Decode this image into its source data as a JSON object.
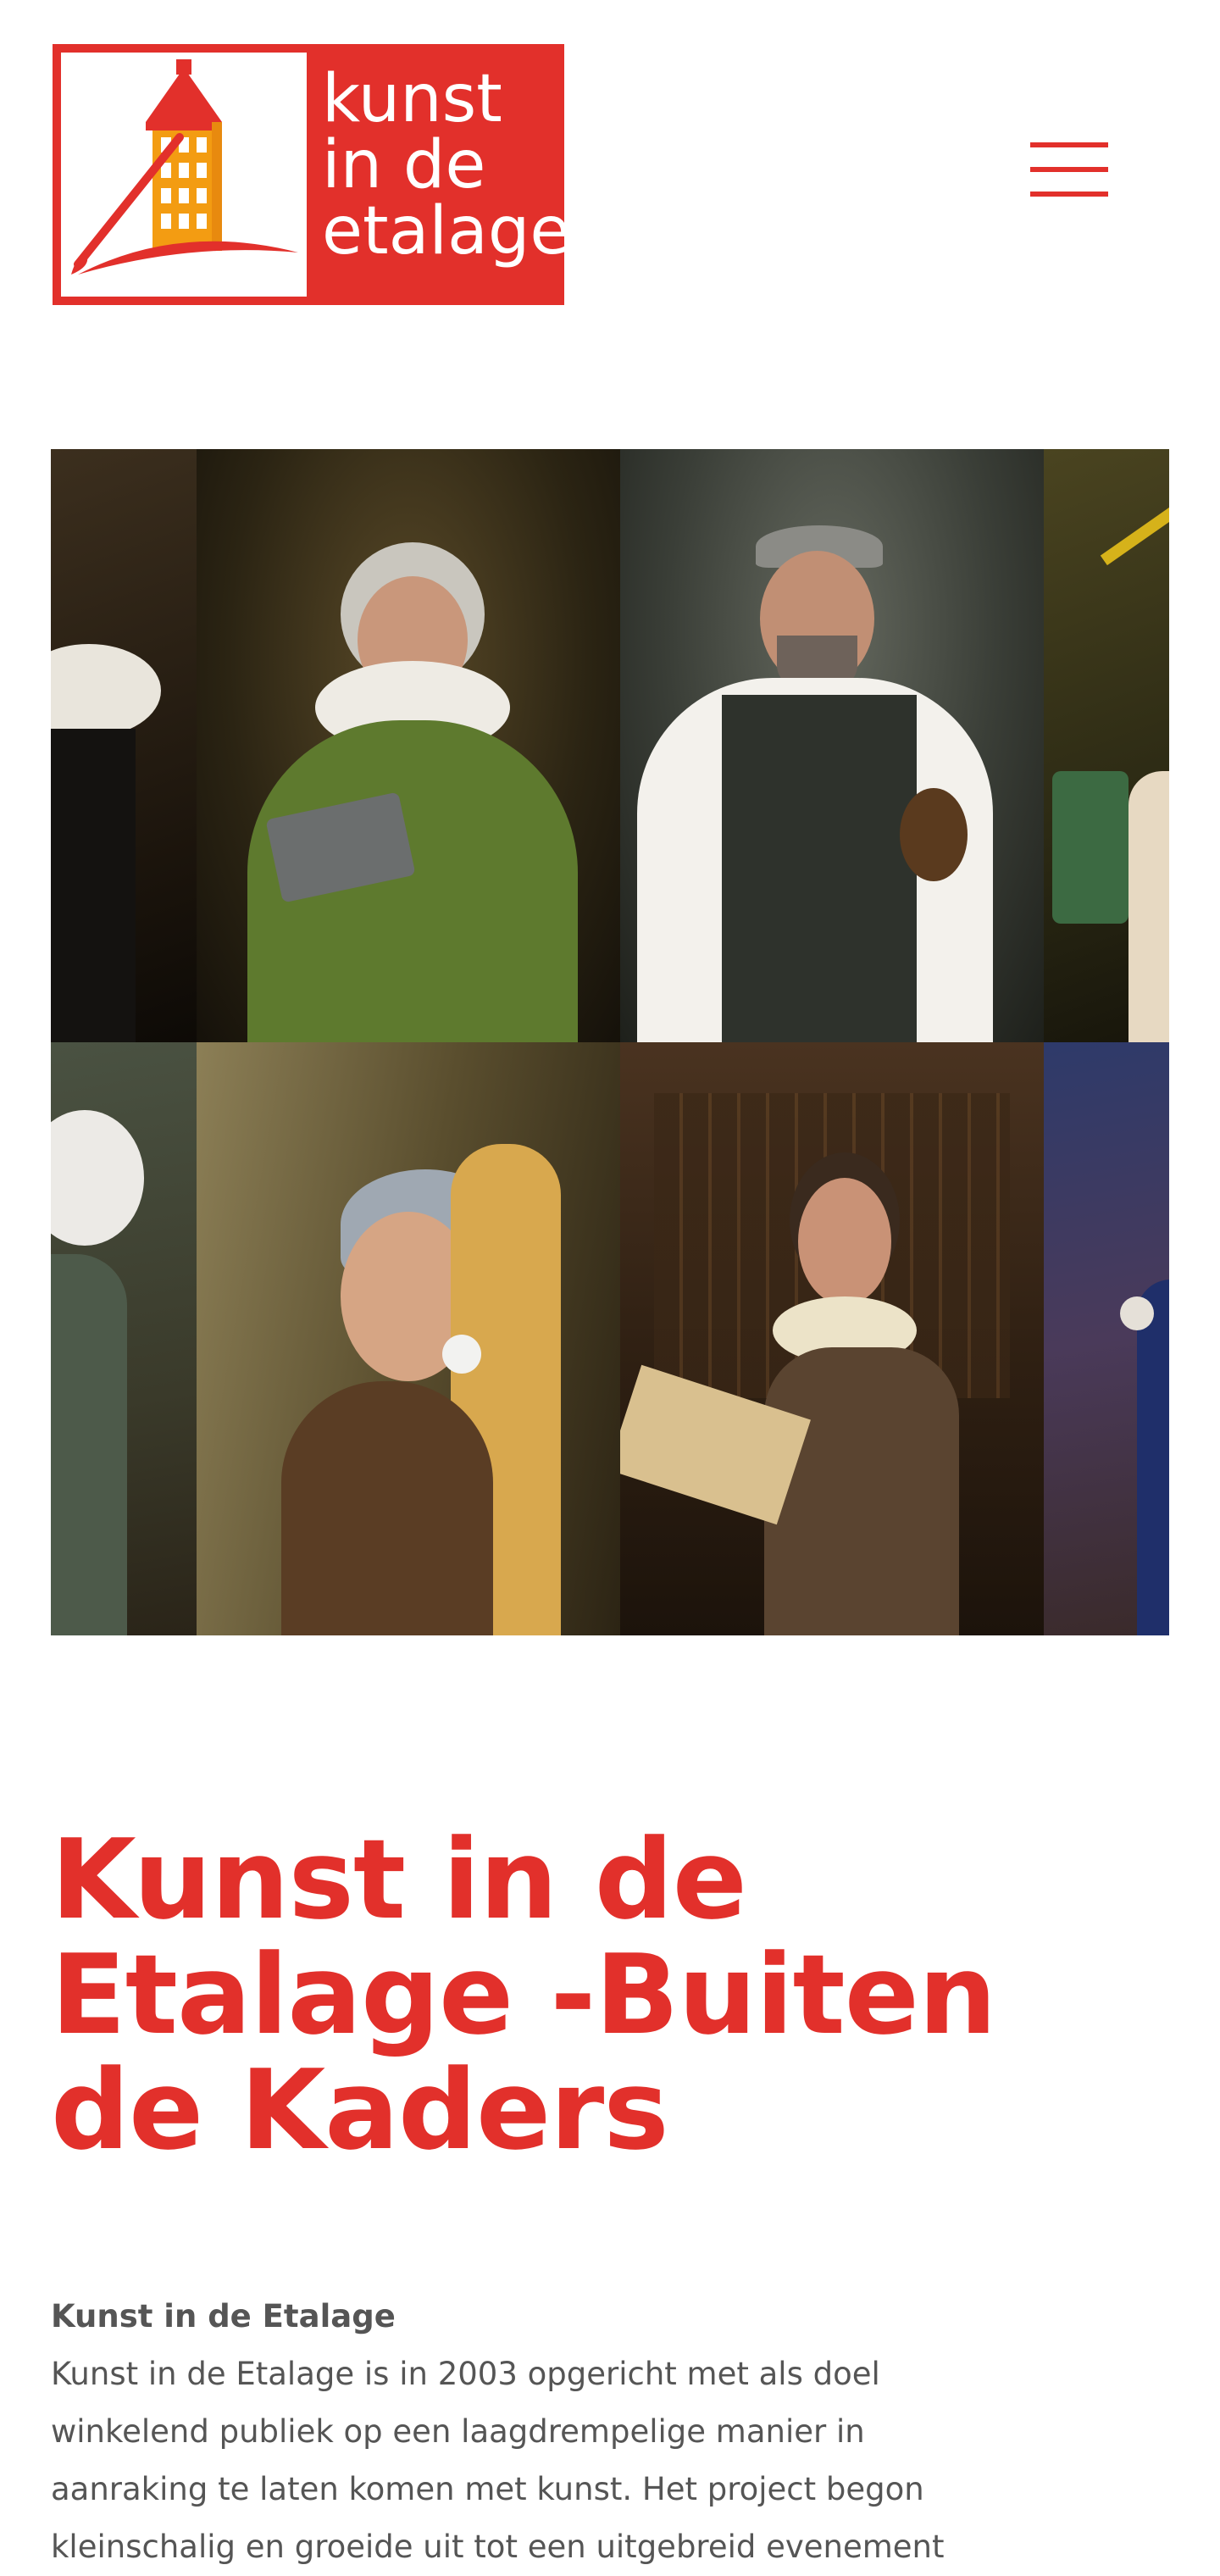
{
  "header": {
    "logo": {
      "text_lines": [
        "kunst",
        "in de",
        "etalage"
      ],
      "alt": "Kunst in de Etalage"
    },
    "menu_icon": "hamburger-menu-icon"
  },
  "hero": {
    "description": "photo collage of portraits in classical painting style"
  },
  "main": {
    "title_lines": [
      "Kunst in de",
      "Etalage -Buiten",
      "de Kaders"
    ],
    "intro_heading": "Kunst in de Etalage",
    "intro_lines": [
      "Kunst in de Etalage is in 2003 opgericht met als doel",
      "winkelend publiek op een laagdrempelige manier in",
      "aanraking te laten komen met kunst. Het project begon",
      "kleinschalig en groeide uit tot een uitgebreid evenement"
    ]
  },
  "colors": {
    "brand_red": "#e2302b",
    "body_text": "#555555",
    "logo_orange": "#f39c12"
  }
}
